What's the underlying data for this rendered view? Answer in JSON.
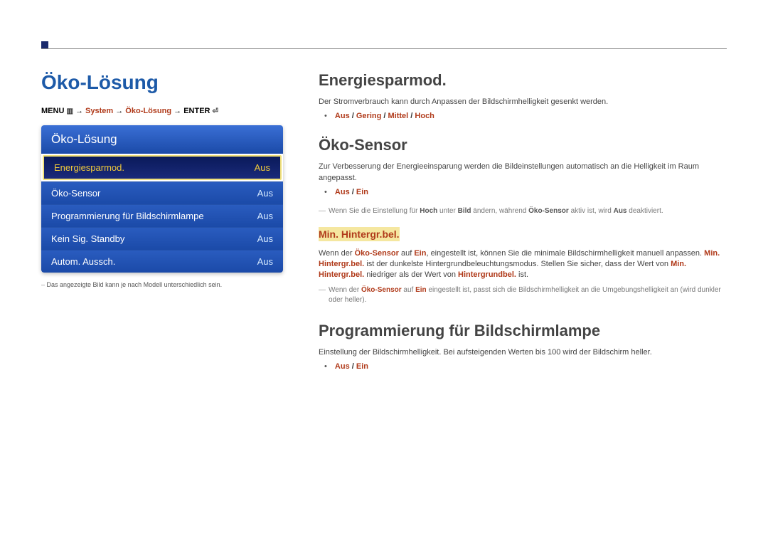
{
  "page_title": "Öko-Lösung",
  "breadcrumb": {
    "menu": "MENU",
    "menu_icon": "▥",
    "arrow": "→",
    "system": "System",
    "oeko": "Öko-Lösung",
    "enter": "ENTER",
    "enter_icon": "⏎"
  },
  "menu": {
    "header": "Öko-Lösung",
    "items": [
      {
        "label": "Energiesparmod.",
        "value": "Aus",
        "selected": true
      },
      {
        "label": "Öko-Sensor",
        "value": "Aus",
        "selected": false
      },
      {
        "label": "Programmierung für Bildschirmlampe",
        "value": "Aus",
        "selected": false
      },
      {
        "label": "Kein Sig. Standby",
        "value": "Aus",
        "selected": false
      },
      {
        "label": "Autom. Aussch.",
        "value": "Aus",
        "selected": false
      }
    ]
  },
  "footnote": "Das angezeigte Bild kann je nach Modell unterschiedlich sein.",
  "sections": {
    "energiesparmod": {
      "title": "Energiesparmod.",
      "text": "Der Stromverbrauch kann durch Anpassen der Bildschirmhelligkeit gesenkt werden.",
      "options": [
        "Aus",
        "Gering",
        "Mittel",
        "Hoch"
      ]
    },
    "oekosensor": {
      "title": "Öko-Sensor",
      "text": "Zur Verbesserung der Energieeinsparung werden die Bildeinstellungen automatisch an die Helligkeit im Raum angepasst.",
      "options": [
        "Aus",
        "Ein"
      ],
      "note1_pre": "Wenn Sie die Einstellung für ",
      "note1_b1": "Hoch",
      "note1_mid1": " unter ",
      "note1_b2": "Bild",
      "note1_mid2": " ändern, während ",
      "note1_b3": "Öko-Sensor",
      "note1_mid3": " aktiv ist, wird ",
      "note1_b4": "Aus",
      "note1_post": " deaktiviert.",
      "sub_heading": "Min. Hintergr.bel.",
      "sub_text_pre": "Wenn der ",
      "sub_text_b1": "Öko-Sensor",
      "sub_text_m1": " auf ",
      "sub_text_b2": "Ein",
      "sub_text_m2": ", eingestellt ist, können Sie die minimale Bildschirmhelligkeit manuell anpassen. ",
      "sub_text_b3": "Min. Hintergr.bel.",
      "sub_text_m3": " ist der dunkelste Hintergrundbeleuchtungsmodus. Stellen Sie sicher, dass der Wert von ",
      "sub_text_b4": "Min. Hintergr.bel.",
      "sub_text_m4": " niedriger als der Wert von ",
      "sub_text_b5": "Hintergrundbel.",
      "sub_text_m5": " ist.",
      "note2_pre": "Wenn der ",
      "note2_b1": "Öko-Sensor",
      "note2_m1": " auf ",
      "note2_b2": "Ein",
      "note2_post": " eingestellt ist, passt sich die Bildschirmhelligkeit an die Umgebungshelligkeit an (wird dunkler oder heller)."
    },
    "programmierung": {
      "title": "Programmierung für Bildschirmlampe",
      "text": "Einstellung der Bildschirmhelligkeit. Bei aufsteigenden Werten bis 100 wird der Bildschirm heller.",
      "options": [
        "Aus",
        "Ein"
      ]
    }
  }
}
